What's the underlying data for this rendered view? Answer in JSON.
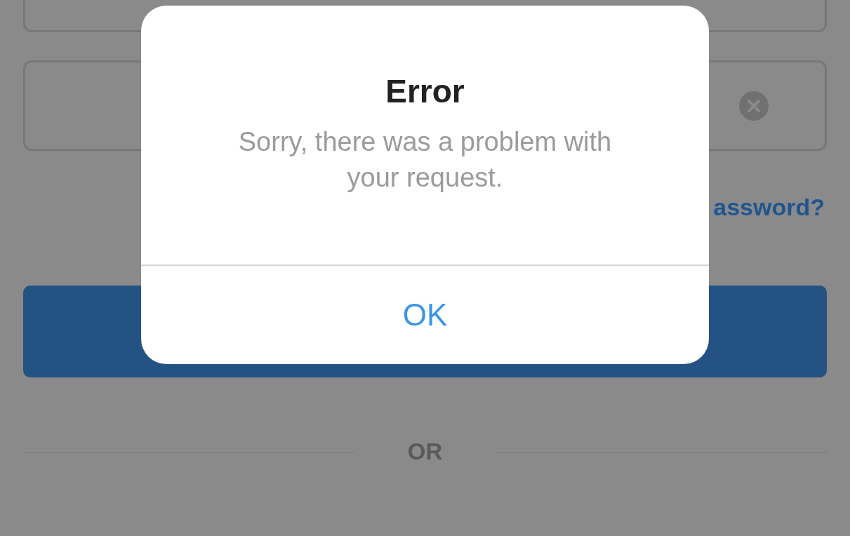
{
  "form": {
    "fields": [
      {
        "clear_button": false
      },
      {
        "clear_button": true
      }
    ],
    "link": "assword?",
    "divider": "OR"
  },
  "dialog": {
    "title": "Error",
    "message": "Sorry, there was a problem with your request.",
    "buttons": [
      "OK"
    ]
  }
}
